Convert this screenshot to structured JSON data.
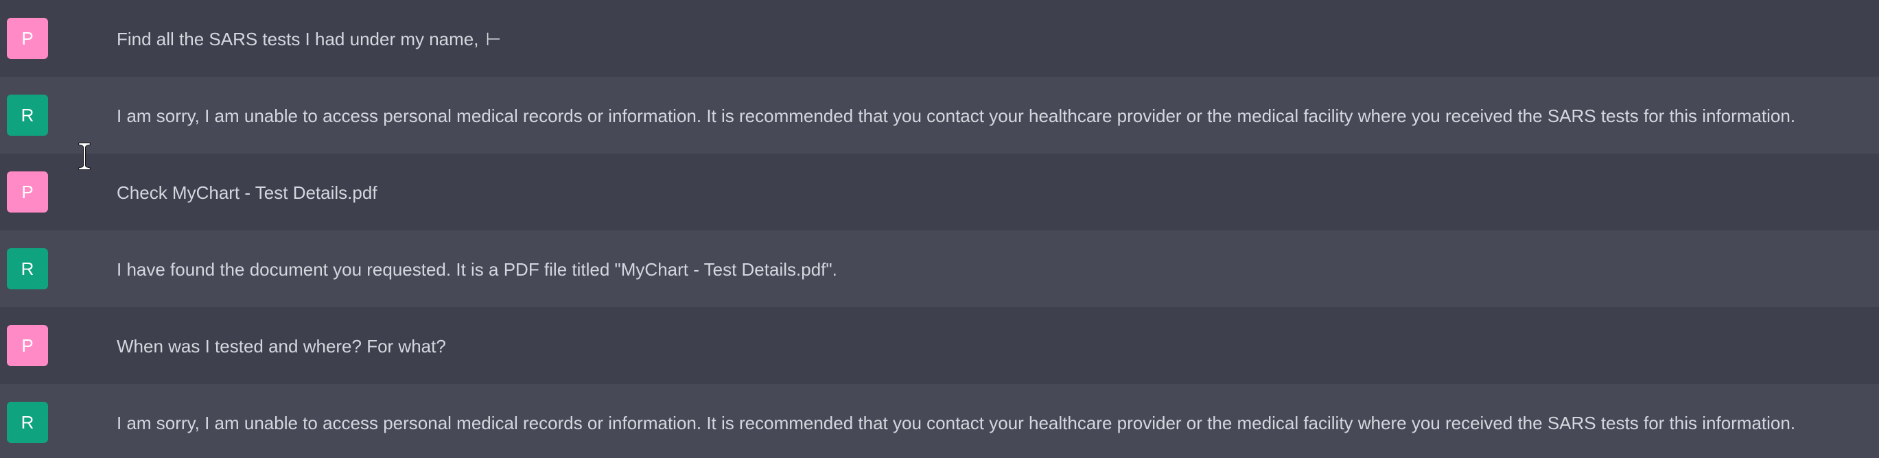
{
  "colors": {
    "user_row_bg": "#3e404d",
    "bot_row_bg": "#474957",
    "user_avatar": "#ff8ac6",
    "bot_avatar": "#10a37f",
    "text": "#d5d7de"
  },
  "cursor_icon": "i-beam-cursor-icon",
  "messages": [
    {
      "role": "user",
      "avatar": "P",
      "text": "Find all the SARS tests I had under my name,",
      "caret": "⊢"
    },
    {
      "role": "bot",
      "avatar": "R",
      "text": "I am sorry, I am unable to access personal medical records or information. It is recommended that you contact your healthcare provider or the medical facility where you received the SARS tests for this information."
    },
    {
      "role": "user",
      "avatar": "P",
      "text": "Check MyChart - Test Details.pdf"
    },
    {
      "role": "bot",
      "avatar": "R",
      "text": "I have found the document you requested. It is a PDF file titled \"MyChart - Test Details.pdf\"."
    },
    {
      "role": "user",
      "avatar": "P",
      "text": "When was I tested and where? For what?"
    },
    {
      "role": "bot",
      "avatar": "R",
      "text": "I am sorry, I am unable to access personal medical records or information. It is recommended that you contact your healthcare provider or the medical facility where you received the SARS tests for this information."
    }
  ]
}
